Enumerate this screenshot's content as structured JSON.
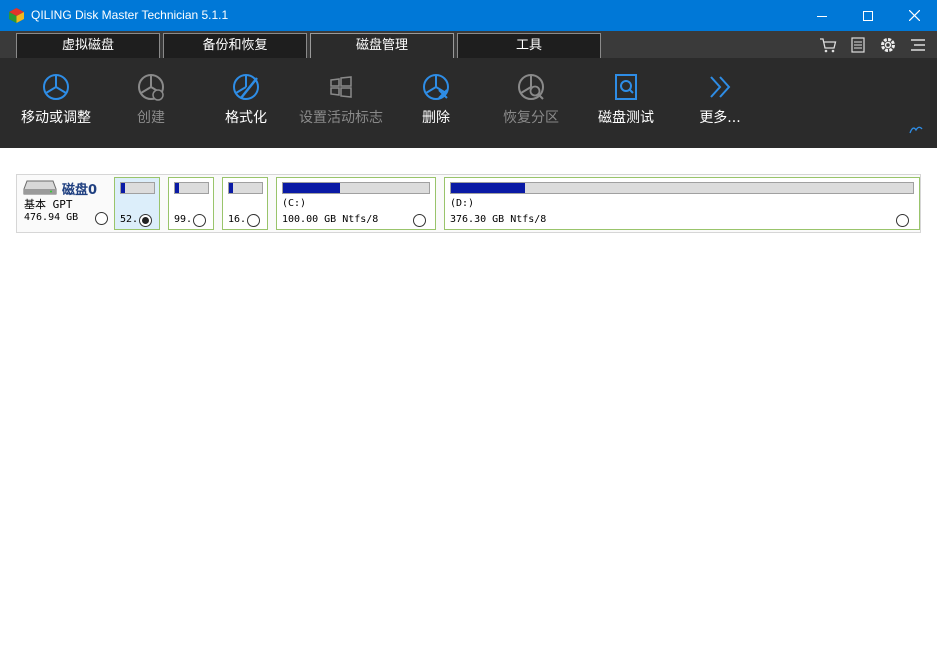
{
  "window": {
    "title": "QILING Disk Master Technician 5.1.1"
  },
  "tabs": [
    {
      "label": "虚拟磁盘"
    },
    {
      "label": "备份和恢复"
    },
    {
      "label": "磁盘管理"
    },
    {
      "label": "工具"
    }
  ],
  "active_tab": "磁盘管理",
  "toolbar": {
    "items": [
      {
        "label": "移动或调整",
        "enabled": true
      },
      {
        "label": "创建",
        "enabled": false
      },
      {
        "label": "格式化",
        "enabled": true
      },
      {
        "label": "设置活动标志",
        "enabled": false
      },
      {
        "label": "删除",
        "enabled": true
      },
      {
        "label": "恢复分区",
        "enabled": false
      },
      {
        "label": "磁盘测试",
        "enabled": true
      },
      {
        "label": "更多...",
        "enabled": true
      }
    ]
  },
  "disk": {
    "name": "磁盘0",
    "type": "基本 GPT",
    "size": "476.94 GB",
    "partitions": [
      {
        "label": "",
        "size": "52.",
        "usage": 0.1,
        "selected": true
      },
      {
        "label": "",
        "size": "99.",
        "usage": 0.1,
        "selected": false
      },
      {
        "label": "",
        "size": "16.",
        "usage": 0.1,
        "selected": false
      },
      {
        "label": "(C:)",
        "size": "100.00 GB Ntfs/8",
        "usage": 0.39,
        "selected": false
      },
      {
        "label": "(D:)",
        "size": "376.30 GB Ntfs/8",
        "usage": 0.16,
        "selected": false
      }
    ]
  },
  "colors": {
    "titlebar": "#0078d7",
    "toolbar": "#2b2b2b",
    "icon_on": "#2e8de6",
    "icon_off": "#8a8a8a",
    "usage_fill": "#0a1aa5",
    "partition_border": "#99c46b"
  }
}
